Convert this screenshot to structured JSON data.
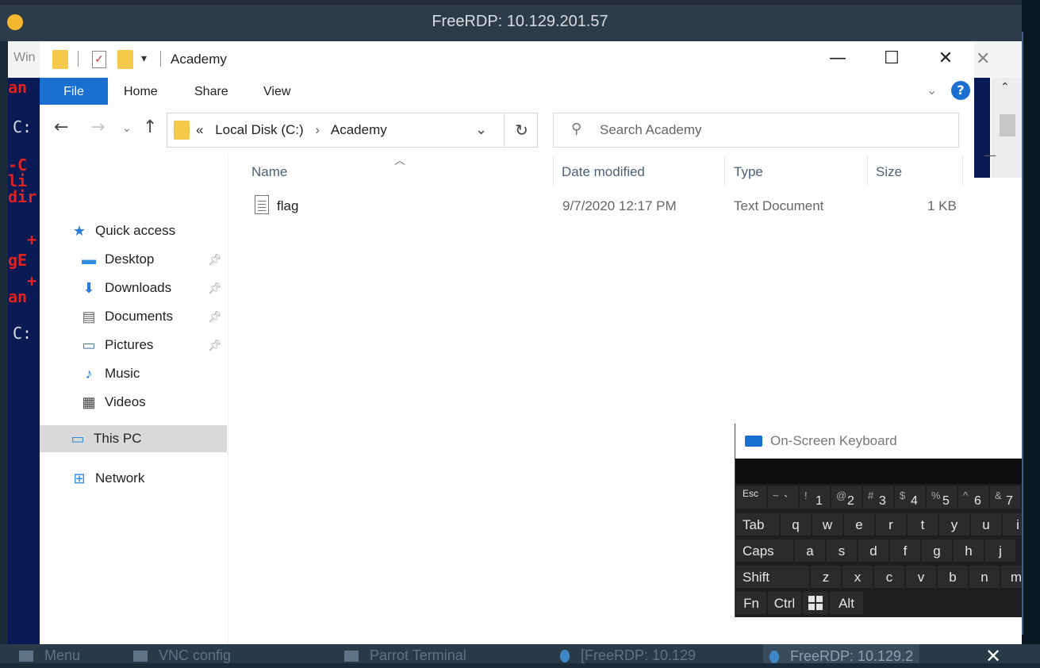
{
  "outer_window": {
    "title": "FreeRDP: 10.129.201.57"
  },
  "background_terminal": {
    "lines": [
      "an",
      "C:",
      "-C",
      "li",
      "dir",
      "+",
      "gE",
      "+",
      "an",
      "C:"
    ]
  },
  "background_window_title": "Win",
  "explorer": {
    "title": "Academy",
    "ribbon_tabs": [
      "File",
      "Home",
      "Share",
      "View"
    ],
    "address": {
      "crumbs": [
        "Local Disk (C:)",
        "Academy"
      ],
      "overflow": "«"
    },
    "search": {
      "placeholder": "Search Academy"
    },
    "nav": [
      {
        "label": "Quick access",
        "icon": "star-icon"
      },
      {
        "label": "Desktop",
        "icon": "desktop-icon",
        "pinned": true
      },
      {
        "label": "Downloads",
        "icon": "download-icon",
        "pinned": true
      },
      {
        "label": "Documents",
        "icon": "document-icon",
        "pinned": true
      },
      {
        "label": "Pictures",
        "icon": "picture-icon",
        "pinned": true
      },
      {
        "label": "Music",
        "icon": "music-icon"
      },
      {
        "label": "Videos",
        "icon": "video-icon"
      },
      {
        "label": "This PC",
        "icon": "pc-icon",
        "selected": true
      },
      {
        "label": "Network",
        "icon": "network-icon"
      }
    ],
    "columns": [
      "Name",
      "Date modified",
      "Type",
      "Size"
    ],
    "files": [
      {
        "name": "flag",
        "date_modified": "9/7/2020 12:17 PM",
        "type": "Text Document",
        "size": "1 KB"
      }
    ]
  },
  "osk": {
    "title": "On-Screen Keyboard",
    "rows": {
      "row1": [
        {
          "label": "Esc"
        },
        {
          "shift": "~",
          "main": "`"
        },
        {
          "shift": "!",
          "main": "1"
        },
        {
          "shift": "@",
          "main": "2"
        },
        {
          "shift": "#",
          "main": "3"
        },
        {
          "shift": "$",
          "main": "4"
        },
        {
          "shift": "%",
          "main": "5"
        },
        {
          "shift": "^",
          "main": "6"
        },
        {
          "shift": "&",
          "main": "7"
        }
      ],
      "row2": [
        "Tab",
        "q",
        "w",
        "e",
        "r",
        "t",
        "y",
        "u",
        "i"
      ],
      "row3": [
        "Caps",
        "a",
        "s",
        "d",
        "f",
        "g",
        "h",
        "j"
      ],
      "row4": [
        "Shift",
        "z",
        "x",
        "c",
        "v",
        "b",
        "n",
        "m"
      ],
      "row5": [
        "Fn",
        "Ctrl",
        "",
        "Alt"
      ]
    }
  },
  "taskbar": {
    "items": [
      "Menu",
      "VNC config",
      "Parrot Terminal",
      "[FreeRDP: 10.129",
      "FreeRDP: 10.129.2"
    ]
  },
  "colors": {
    "accent": "#1a6fd1",
    "folder": "#f5c84a",
    "terminal_bg": "#0a1a55",
    "terminal_text": "#e0231f"
  }
}
